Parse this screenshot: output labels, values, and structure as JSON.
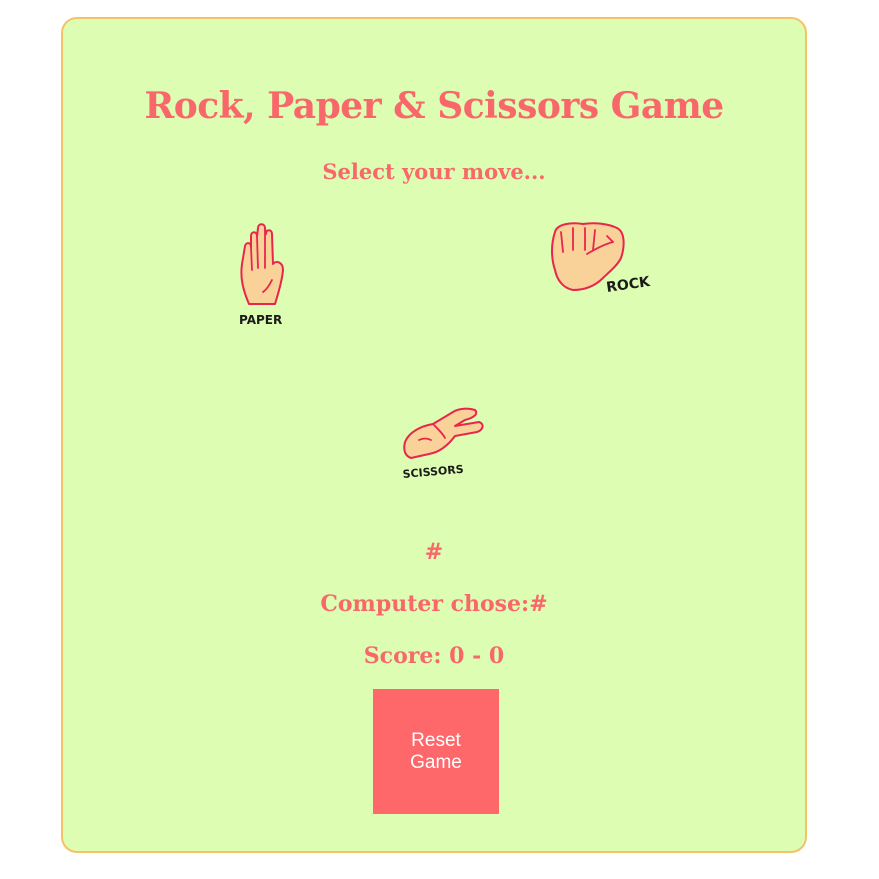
{
  "header": {
    "title": "Rock, Paper & Scissors Game",
    "subtitle": "Select your move..."
  },
  "moves": [
    {
      "id": "paper",
      "label": "PAPER"
    },
    {
      "id": "rock",
      "label": "ROCK"
    },
    {
      "id": "scissors",
      "label": "SCISSORS"
    }
  ],
  "result": {
    "outcome": "#",
    "computer_prefix": "Computer chose:",
    "computer_choice": "#",
    "score_prefix": "Score:",
    "score_value": "0 - 0"
  },
  "controls": {
    "reset_label": "Reset Game"
  },
  "colors": {
    "card_background": "#dcfdb2",
    "card_border": "#f6c266",
    "text_accent": "#f8686a",
    "button_background": "#ff686b",
    "hand_fill": "#f9d29a",
    "hand_outline": "#e8264c"
  }
}
